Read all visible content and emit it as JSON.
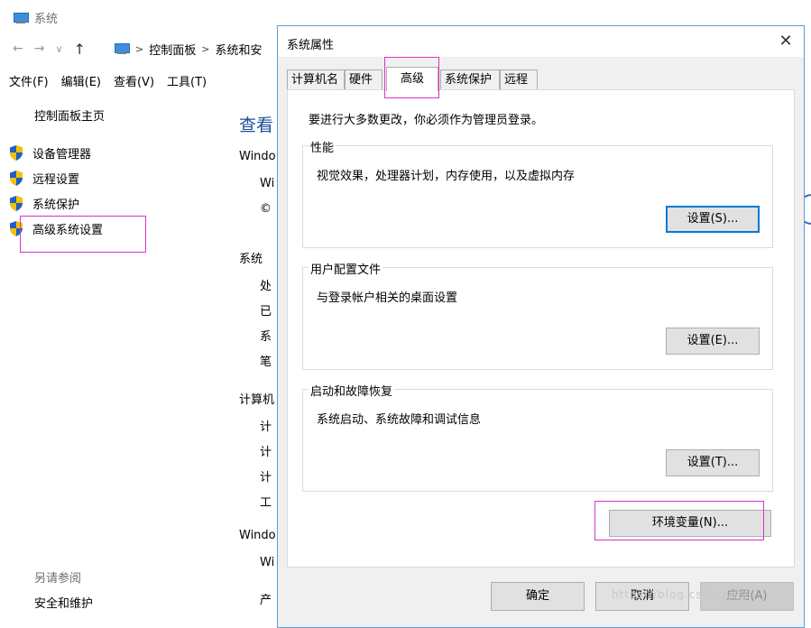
{
  "background_window": {
    "title": "系统",
    "nav": {
      "back": "←",
      "forward": "→",
      "recent": "∨",
      "up": "↑"
    },
    "address": [
      "控制面板",
      "系统和安"
    ],
    "address_sep": ">",
    "menu": [
      "文件(F)",
      "编辑(E)",
      "查看(V)",
      "工具(T)"
    ],
    "left_pane": {
      "home": "控制面板主页",
      "items": [
        "设备管理器",
        "远程设置",
        "系统保护",
        "高级系统设置"
      ],
      "see_also": "另请参阅",
      "security": "安全和维护"
    },
    "main_fragments": {
      "heading": "查看",
      "col": [
        "Windo",
        "Wi",
        "©",
        "系统",
        "处",
        "已",
        "系",
        "笔",
        "计算机",
        "计",
        "计",
        "计",
        "工",
        "Windo",
        "Wi",
        "产"
      ]
    }
  },
  "dialog": {
    "title": "系统属性",
    "close": "✕",
    "tabs": [
      "计算机名",
      "硬件",
      "高级",
      "系统保护",
      "远程"
    ],
    "active_tab": "高级",
    "admin_note": "要进行大多数更改，你必须作为管理员登录。",
    "groups": [
      {
        "title": "性能",
        "desc": "视觉效果，处理器计划，内存使用，以及虚拟内存",
        "button": "设置(S)..."
      },
      {
        "title": "用户配置文件",
        "desc": "与登录帐户相关的桌面设置",
        "button": "设置(E)..."
      },
      {
        "title": "启动和故障恢复",
        "desc": "系统启动、系统故障和调试信息",
        "button": "设置(T)..."
      }
    ],
    "env_button": "环境变量(N)...",
    "ok": "确定",
    "cancel": "取消",
    "apply": "应用(A)"
  },
  "colors": {
    "highlight": "#d633c9",
    "accent": "#0078d7",
    "dialog_border": "#5b9bd5"
  },
  "watermark": "https://blog.csdn.net/..."
}
